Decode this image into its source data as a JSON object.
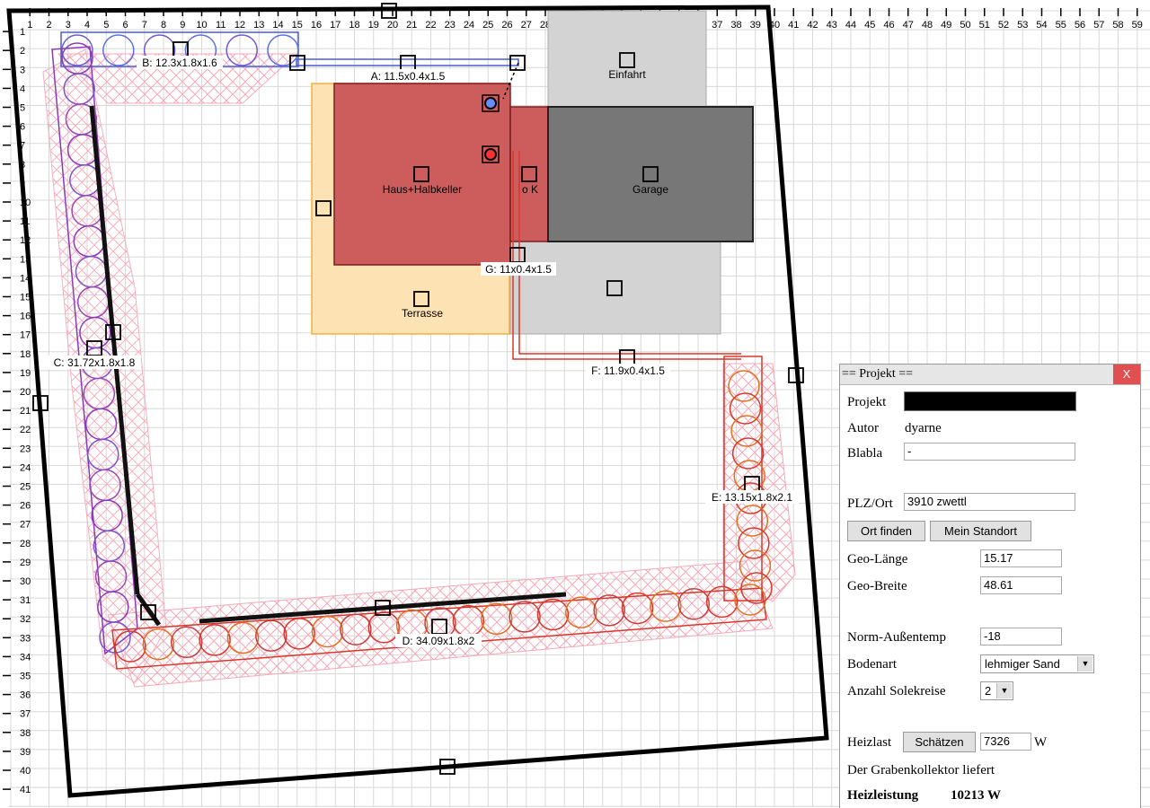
{
  "plan": {
    "labels": {
      "A": "A: 11.5x0.4x1.5",
      "B": "B: 12.3x1.8x1.6",
      "C": "C: 31.72x1.8x1.8",
      "D": "D: 34.09x1.8x2",
      "E": "E: 13.15x1.8x2.1",
      "F": "F: 11.9x0.4x1.5",
      "G": "G: 11x0.4x1.5",
      "house": "Haus+Halbkeller",
      "garage": "Garage",
      "terrace": "Terrasse",
      "driveway": "Einfahrt",
      "annex": "o K"
    },
    "colors": {
      "house": "#cd5c5c",
      "garage": "#777777",
      "terrace": "#fde3b4",
      "driveway": "#d3d3d3",
      "pipe_blue": "#6a5acd",
      "pipe_purple": "#8a3ab9",
      "pipe_red": "#d9362b",
      "pipe_orange": "#e07020",
      "hatch": "#f5a8b8"
    }
  },
  "panel": {
    "title": "== Projekt ==",
    "close": "X",
    "projekt_label": "Projekt",
    "autor_label": "Autor",
    "autor_value": "dyarne",
    "blabla_label": "Blabla",
    "blabla_value": "-",
    "plz_label": "PLZ/Ort",
    "plz_value": "3910 zwettl",
    "btn_find": "Ort finden",
    "btn_location": "Mein Standort",
    "geo_lon_label": "Geo-Länge",
    "geo_lon_value": "15.17",
    "geo_lat_label": "Geo-Breite",
    "geo_lat_value": "48.61",
    "norm_label": "Norm-Außentemp",
    "norm_value": "-18",
    "boden_label": "Bodenart",
    "boden_value": "lehmiger Sand",
    "sole_label": "Anzahl Solekreise",
    "sole_value": "2",
    "heizlast_label": "Heizlast",
    "btn_estimate": "Schätzen",
    "heizlast_value": "7326",
    "heizlast_unit": "W",
    "result_text": "Der Grabenkollektor liefert",
    "leistung_label": "Heizleistung",
    "leistung_value": "10213 W"
  }
}
